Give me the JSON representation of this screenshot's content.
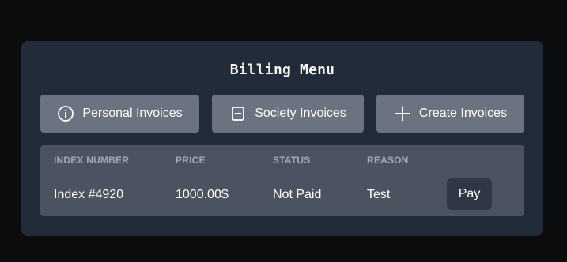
{
  "panel": {
    "title": "Billing Menu"
  },
  "menu": {
    "buttons": [
      {
        "label": "Personal Invoices",
        "icon": "info-circle-icon"
      },
      {
        "label": "Society Invoices",
        "icon": "minus-square-icon"
      },
      {
        "label": "Create Invoices",
        "icon": "plus-icon"
      }
    ]
  },
  "table": {
    "headers": [
      "INDEX NUMBER",
      "PRICE",
      "STATUS",
      "REASON"
    ],
    "rows": [
      {
        "index": "Index #4920",
        "price": "1000.00$",
        "status": "Not Paid",
        "reason": "Test",
        "action": "Pay"
      }
    ]
  },
  "colors": {
    "background": "#0b0c0e",
    "panel": "#222b38",
    "button": "#6b7380",
    "table": "#4b5260",
    "pay_button": "#2f3644",
    "text": "#ffffff",
    "header_text": "#a3a9b3"
  }
}
